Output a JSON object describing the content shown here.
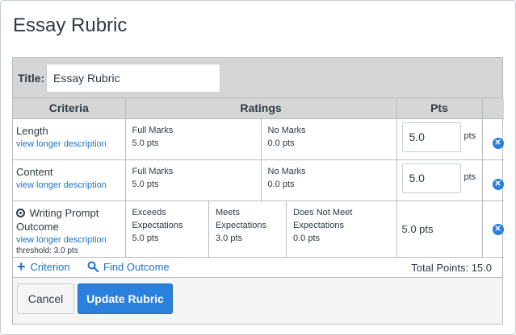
{
  "page": {
    "heading": "Essay Rubric"
  },
  "rubric": {
    "title_label": "Title:",
    "title_value": "Essay Rubric",
    "headers": {
      "criteria": "Criteria",
      "ratings": "Ratings",
      "pts": "Pts"
    },
    "criteria": [
      {
        "title": "Length",
        "link": "view longer description",
        "ratings": [
          {
            "label": "Full Marks",
            "pts": "5.0 pts"
          },
          {
            "label": "No Marks",
            "pts": "0.0 pts"
          }
        ],
        "points": "5.0",
        "pts_unit": "pts"
      },
      {
        "title": "Content",
        "link": "view longer description",
        "ratings": [
          {
            "label": "Full Marks",
            "pts": "5.0 pts"
          },
          {
            "label": "No Marks",
            "pts": "0.0 pts"
          }
        ],
        "points": "5.0",
        "pts_unit": "pts"
      },
      {
        "title": "Writing Prompt Outcome",
        "link": "view longer description",
        "threshold": "threshold: 3.0 pts",
        "ratings": [
          {
            "label": "Exceeds Expectations",
            "pts": "5.0 pts"
          },
          {
            "label": "Meets Expectations",
            "pts": "3.0 pts"
          },
          {
            "label": "Does Not Meet Expectations",
            "pts": "0.0 pts"
          }
        ],
        "points_text": "5.0 pts"
      }
    ],
    "footer": {
      "add_criterion": "Criterion",
      "find_outcome": "Find Outcome",
      "total": "Total Points: 15.0"
    }
  },
  "buttons": {
    "cancel": "Cancel",
    "update": "Update Rubric"
  },
  "colors": {
    "accent": "#2b7fdd",
    "link": "#1a73c7",
    "header_bg": "#d6d6d6",
    "text": "#2d3b45"
  },
  "icons": {
    "delete": "close-circle-icon",
    "add": "plus-icon",
    "search": "search-icon",
    "outcome": "target-icon"
  }
}
